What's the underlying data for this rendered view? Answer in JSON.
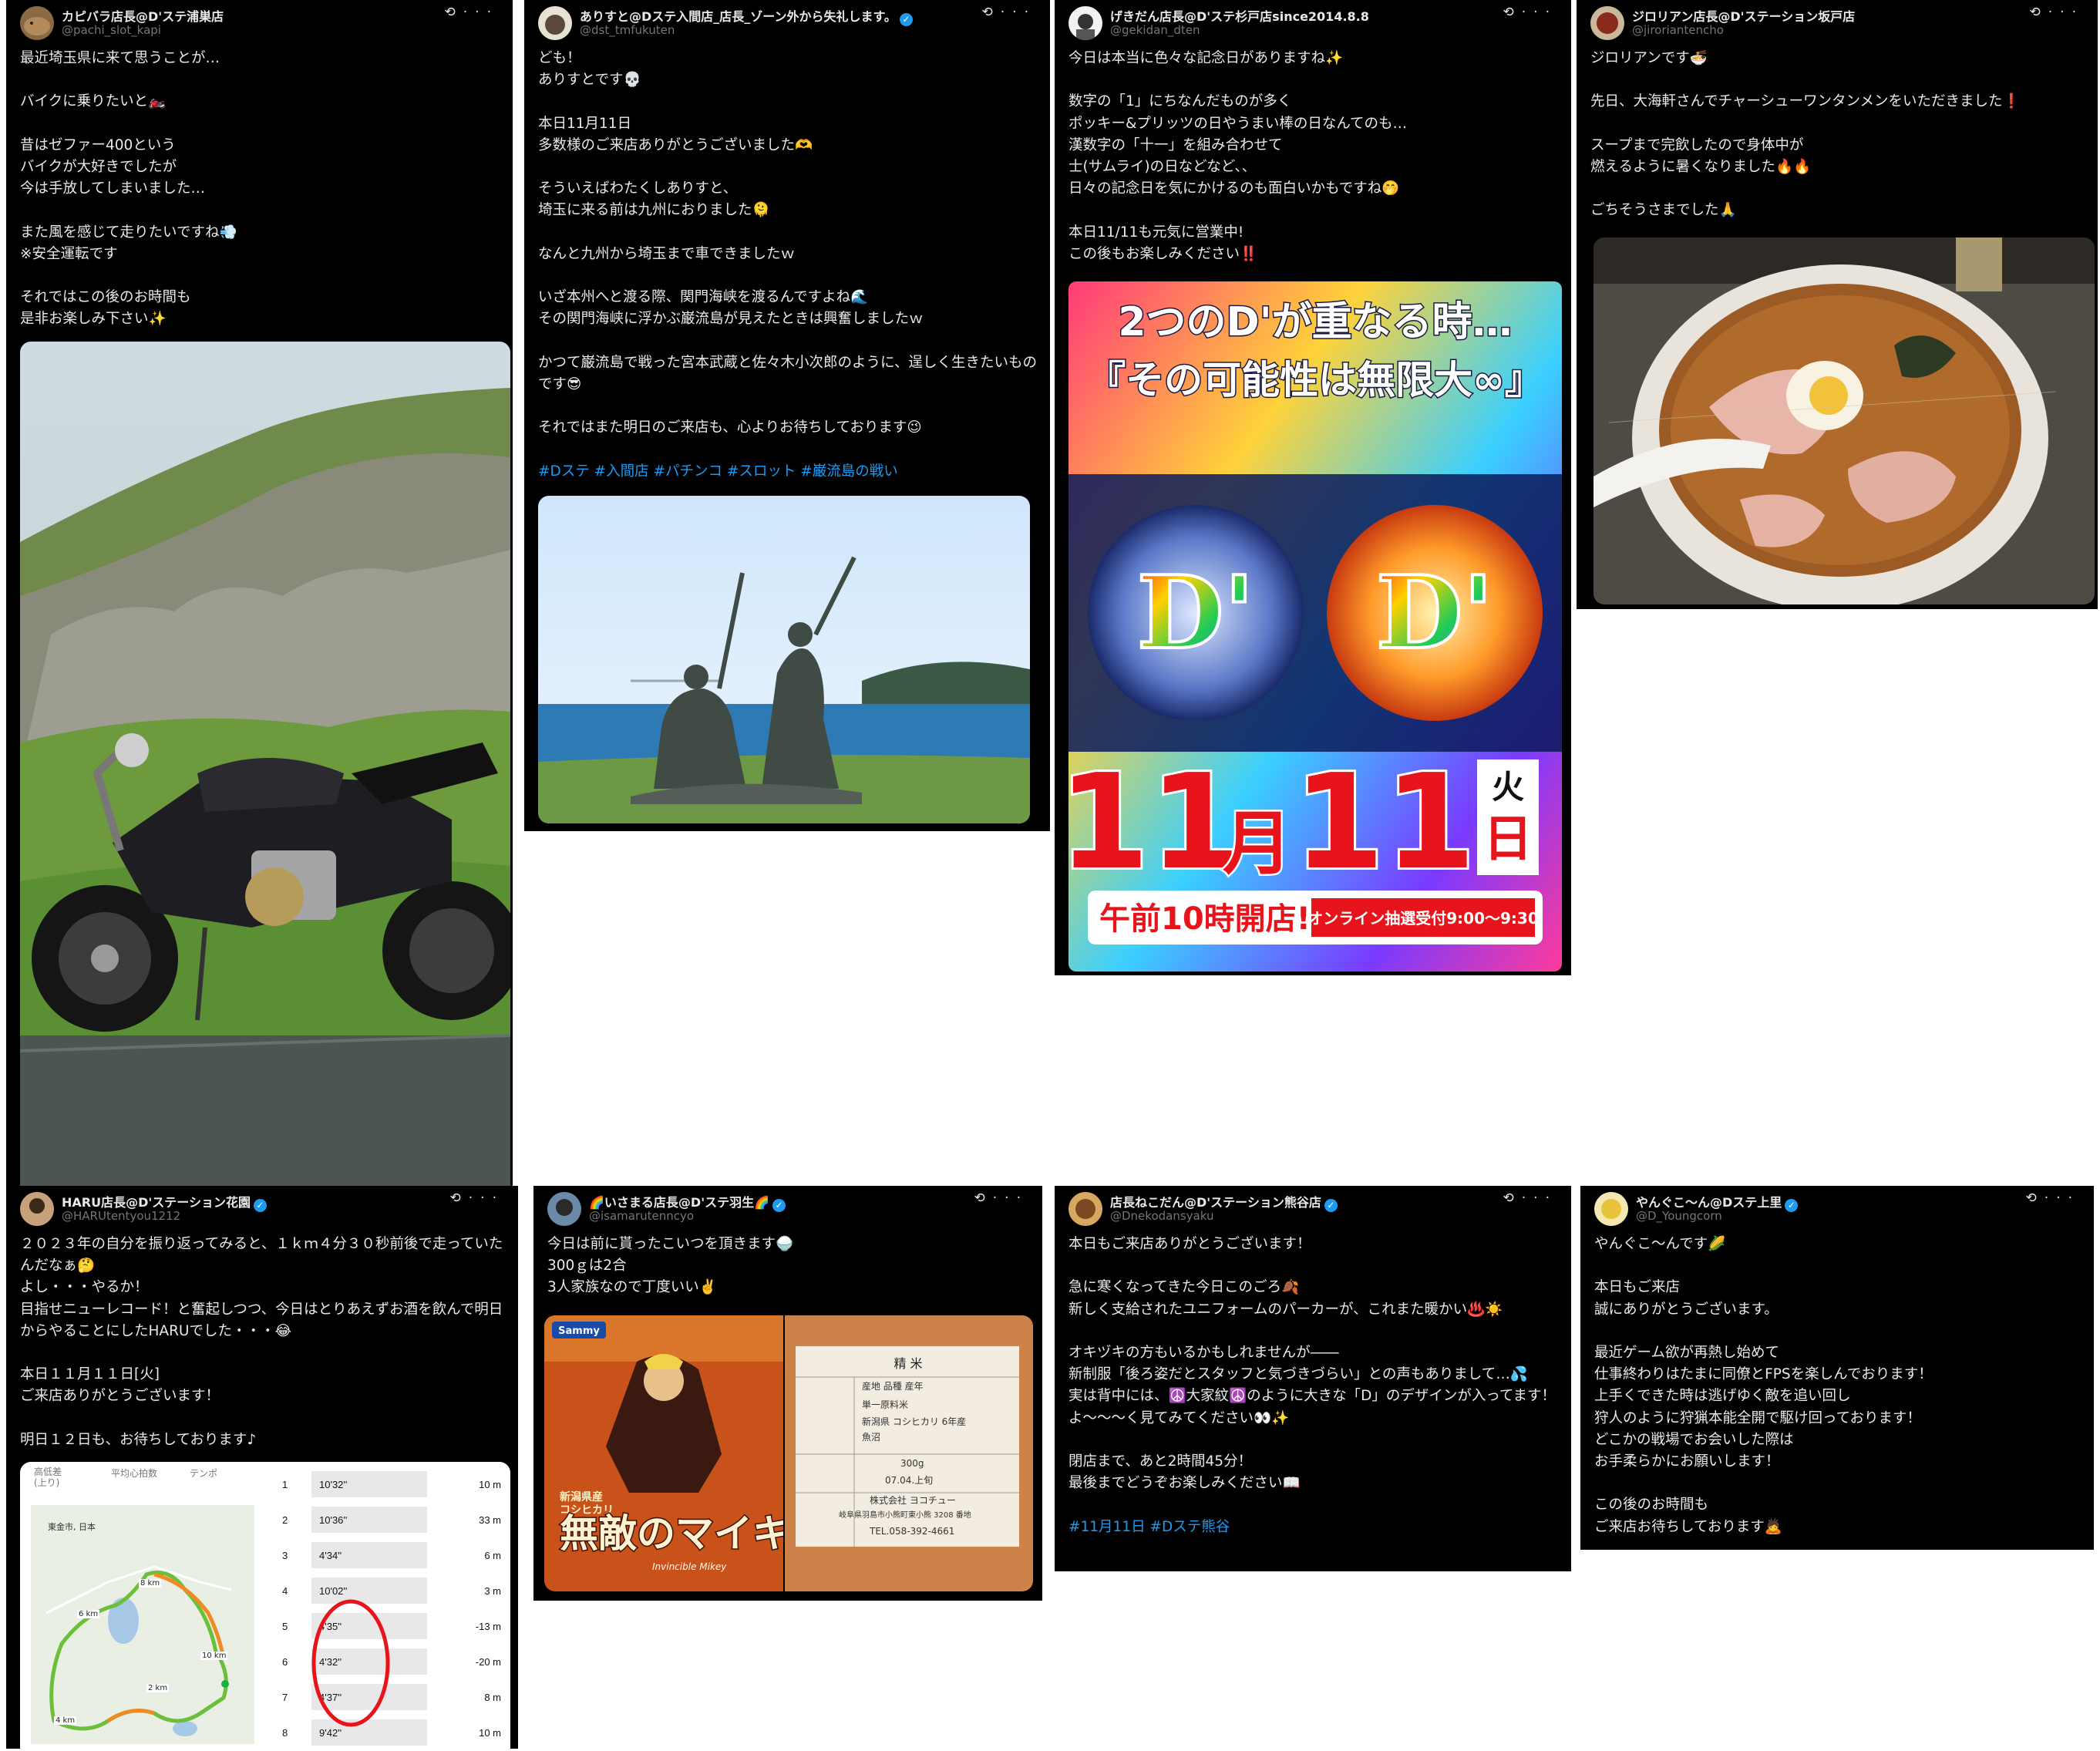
{
  "posts": [
    {
      "name": "カピバラ店長@D'ステ浦巣店",
      "handle": "@pachi_slot_kapi",
      "verified": false,
      "text": "最近埼玉県に来て思うことが…\n\nバイクに乗りたいと🏍️\n\n昔はゼファー400という\nバイクが大好きでしたが\n今は手放してしまいました…\n\nまた風を感じて走りたいですね💨\n※安全運転です\n\nそれではこの後のお時間も\n是非お楽しみ下さい✨",
      "media": "motorcycle-photo"
    },
    {
      "name": "ありすと@Dステ入間店_店長_ゾーン外から失礼します。",
      "handle": "@dst_tmfukuten",
      "verified": true,
      "text": "ども！\nありすとです💀\n\n本日11月11日\n多数様のご来店ありがとうございました🫶\n\nそういえばわたくしありすと、\n埼玉に来る前は九州におりました🫠\n\nなんと九州から埼玉まで車できましたｗ\n\nいざ本州へと渡る際、関門海峡を渡るんですよね🌊\nその関門海峡に浮かぶ巌流島が見えたときは興奮しましたｗ\n\nかつて巌流島で戦った宮本武蔵と佐々木小次郎のように、逞しく生きたいものです😎\n\nそれではまた明日のご来店も、心よりお待ちしております😉",
      "hashtags": "#Dステ #入間店 #パチンコ #スロット #巌流島の戦い",
      "media": "statue-photo"
    },
    {
      "name": "げきだん店長@D'ステ杉戸店since2014.8.8",
      "handle": "@gekidan_dten",
      "verified": false,
      "text": "今日は本当に色々な記念日がありますね✨\n\n数字の「1」にちなんだものが多く\nポッキー&プリッツの日やうまい棒の日なんてのも…\n漢数字の「十一」を組み合わせて\n士(サムライ)の日などなど、、\n日々の記念日を気にかけるのも面白いかもですね🤭\n\n本日11/11も元気に営業中!\nこの後もお楽しみください‼️",
      "media": "event-poster",
      "poster": {
        "headline1": "2つのD'が重なる時…",
        "headline2": "『その可能性は無限大∞』",
        "logo": "D'",
        "date_month": "11",
        "date_month_unit": "月",
        "date_day": "11",
        "weekday": "火",
        "day_unit": "日",
        "open": "午前10時開店!",
        "lottery": "オンライン抽選受付9:00～9:30"
      }
    },
    {
      "name": "ジロリアン店長@D'ステーション坂戸店",
      "handle": "@jiroriantencho",
      "verified": false,
      "text": "ジロリアンです🍜\n\n先日、大海軒さんでチャーシューワンタンメンをいただきました❗\n\nスープまで完飲したので身体中が\n燃えるように暑くなりました🔥🔥\n\nごちそうさまでした🙏",
      "media": "ramen-photo"
    },
    {
      "name": "HARU店長@D'ステーション花園",
      "handle": "@HARUtentyou1212",
      "verified": true,
      "text": "２０２３年の自分を振り返ってみると、１ｋｍ４分３０秒前後で走っていたんだなぁ🤔\nよし・・・やるか！\n目指せニューレコード！と奮起しつつ、今日はとりあえずお酒を飲んで明日からやることにしたHARUでした・・・😂\n\n本日１１月１１日[火]\nご来店ありがとうございます！\n\n明日１２日も、お待ちしております♪",
      "media": "run-screenshot",
      "run": {
        "headers": [
          "高低差\n(上り)",
          "平均心拍数",
          "テンポ"
        ],
        "location": "東金市, 日本",
        "km_labels": [
          "8 km",
          "6 km",
          "10 km",
          "2 km",
          "4 km"
        ],
        "splits": [
          {
            "km": "1",
            "pace": "10'32''",
            "elev": "10 m"
          },
          {
            "km": "2",
            "pace": "10'36''",
            "elev": "33 m"
          },
          {
            "km": "3",
            "pace": "4'34''",
            "elev": "6 m"
          },
          {
            "km": "4",
            "pace": "10'02''",
            "elev": "3 m"
          },
          {
            "km": "5",
            "pace": "4'35''",
            "elev": "-13 m"
          },
          {
            "km": "6",
            "pace": "4'32''",
            "elev": "-20 m"
          },
          {
            "km": "7",
            "pace": "4'37''",
            "elev": "8 m"
          },
          {
            "km": "8",
            "pace": "9'42''",
            "elev": "10 m"
          }
        ]
      }
    },
    {
      "name": "🌈いさまる店長@D'ステ羽生🌈",
      "handle": "@isamarutenncyo",
      "verified": true,
      "text": "今日は前に貰ったこいつを頂きます🍚\n300ｇは2合\n3人家族なので丁度いい✌️",
      "media": "rice-package",
      "rice": {
        "brand1": "Sammy",
        "title_small": "新潟県産\nコシヒカリ",
        "title_big": "無敵のマイキー",
        "subtitle": "Invincible Mikey",
        "label_title": "精 米",
        "label_rows": [
          "産地 品種 産年",
          "単一原料米",
          "新潟県 コシヒカリ 6年産",
          "魚沼",
          "300g",
          "07.04.上旬",
          "株式会社 ヨコチュー",
          "岐阜県羽島市小熊町東小熊 3208 番地",
          "TEL.058-392-4661"
        ]
      }
    },
    {
      "name": "店長ねこだん@D'ステーション熊谷店",
      "handle": "@Dnekodansyaku",
      "verified": true,
      "text": "本日もご来店ありがとうございます！\n\n急に寒くなってきた今日このごろ🍂\n新しく支給されたユニフォームのパーカーが、これまた暖かい♨️☀️\n\nオキヅキの方もいるかもしれませんが――\n新制服「後ろ姿だとスタッフと気づきづらい」との声もありまして…💦\n実は背中には、☮️大家紋☮️のように大きな「D」のデザインが入ってます！\nよ〜〜〜く見てみてください👀✨\n\n閉店まで、あと2時間45分！\n最後までどうぞお楽しみください📖",
      "hashtags": "#11月11日 #Dステ熊谷"
    },
    {
      "name": "やんぐこ〜ん@Dステ上里",
      "handle": "@D_Youngcorn",
      "verified": true,
      "text": "やんぐこ〜んです🌽\n\n本日もご来店\n誠にありがとうございます。\n\n最近ゲーム欲が再熱し始めて\n仕事終わりはたまに同僚とFPSを楽しんでおります！\n上手くできた時は逃げゆく敵を追い回し\n狩人のように狩猟本能全開で駆け回っております！\nどこかの戦場でお会いした際は\nお手柔らかにお願いします！\n\nこの後のお時間も\nご来店お待ちしております🙇"
    }
  ],
  "icons": {
    "grok": "⟲",
    "more": "···",
    "verified": "✓"
  }
}
